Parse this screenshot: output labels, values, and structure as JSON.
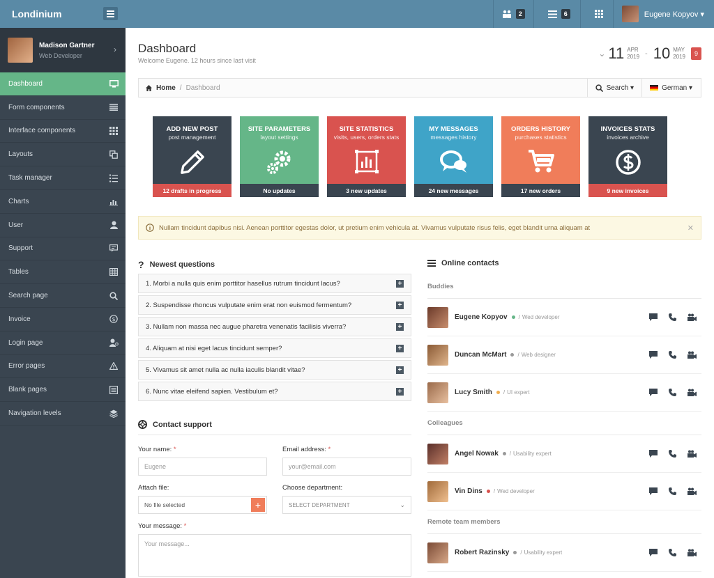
{
  "brand": "Londinium",
  "topbar": {
    "users_count": "2",
    "tasks_count": "6",
    "user_name": "Eugene Kopyov ▾"
  },
  "sidebar": {
    "user_name": "Madison Gartner",
    "user_role": "Web Developer",
    "items": [
      {
        "label": "Dashboard",
        "icon": "monitor-icon"
      },
      {
        "label": "Form components",
        "icon": "list-icon"
      },
      {
        "label": "Interface components",
        "icon": "grid-icon"
      },
      {
        "label": "Layouts",
        "icon": "copy-icon"
      },
      {
        "label": "Task manager",
        "icon": "task-list-icon"
      },
      {
        "label": "Charts",
        "icon": "bar-chart-icon"
      },
      {
        "label": "User",
        "icon": "user-icon"
      },
      {
        "label": "Support",
        "icon": "chat-icon"
      },
      {
        "label": "Tables",
        "icon": "table-icon"
      },
      {
        "label": "Search page",
        "icon": "search-icon"
      },
      {
        "label": "Invoice",
        "icon": "dollar-icon"
      },
      {
        "label": "Login page",
        "icon": "user-key-icon"
      },
      {
        "label": "Error pages",
        "icon": "warning-icon"
      },
      {
        "label": "Blank pages",
        "icon": "blank-page-icon"
      },
      {
        "label": "Navigation levels",
        "icon": "layers-icon"
      }
    ]
  },
  "page": {
    "title": "Dashboard",
    "subtitle": "Welcome Eugene. 12 hours since last visit",
    "date_from_day": "11",
    "date_from_month": "APR",
    "date_from_year": "2019",
    "date_to_day": "10",
    "date_to_month": "MAY",
    "date_to_year": "2019",
    "date_badge": "9"
  },
  "breadcrumb": {
    "home": "Home",
    "current": "Dashboard",
    "search": "Search ▾",
    "language": "German ▾"
  },
  "tiles": [
    {
      "title": "ADD NEW POST",
      "sub": "post management",
      "foot": "12 drafts in progress"
    },
    {
      "title": "SITE PARAMETERS",
      "sub": "layout settings",
      "foot": "No updates"
    },
    {
      "title": "SITE STATISTICS",
      "sub": "visits, users, orders stats",
      "foot": "3 new updates"
    },
    {
      "title": "MY MESSAGES",
      "sub": "messages history",
      "foot": "24 new messages"
    },
    {
      "title": "ORDERS HISTORY",
      "sub": "purchases statistics",
      "foot": "17 new orders"
    },
    {
      "title": "INVOICES STATS",
      "sub": "invoices archive",
      "foot": "9 new invoices"
    }
  ],
  "alert": "Nullam tincidunt dapibus nisi. Aenean porttitor egestas dolor, ut pretium enim vehicula at. Vivamus vulputate risus felis, eget blandit urna aliquam at",
  "questions": {
    "title": "Newest questions",
    "items": [
      "1. Morbi a nulla quis enim porttitor hasellus rutrum tincidunt lacus?",
      "2. Suspendisse rhoncus vulputate enim erat non euismod fermentum?",
      "3. Nullam non massa nec augue pharetra venenatis facilisis viverra?",
      "4. Aliquam at nisi eget lacus tincidunt semper?",
      "5. Vivamus sit amet nulla ac nulla iaculis blandit vitae?",
      "6. Nunc vitae eleifend sapien. Vestibulum et?"
    ]
  },
  "support": {
    "title": "Contact support",
    "name_label": "Your name:",
    "name_value": "Eugene",
    "email_label": "Email address:",
    "email_placeholder": "your@email.com",
    "file_label": "Attach file:",
    "file_value": "No file selected",
    "dept_label": "Choose department:",
    "dept_value": "SELECT DEPARTMENT",
    "message_label": "Your message:",
    "message_placeholder": "Your message..."
  },
  "contacts": {
    "title": "Online contacts",
    "groups": [
      {
        "name": "Buddies",
        "people": [
          {
            "name": "Eugene Kopyov",
            "role": "Wed developer",
            "status": "#65b688"
          },
          {
            "name": "Duncan McMart",
            "role": "Web designer",
            "status": "#999999"
          },
          {
            "name": "Lucy Smith",
            "role": "UI expert",
            "status": "#f0ad4e"
          }
        ]
      },
      {
        "name": "Colleagues",
        "people": [
          {
            "name": "Angel Nowak",
            "role": "Usability expert",
            "status": "#999999"
          },
          {
            "name": "Vin Dins",
            "role": "Wed developer",
            "status": "#d9534f"
          }
        ]
      },
      {
        "name": "Remote team members",
        "people": [
          {
            "name": "Robert Razinsky",
            "role": "Usability expert",
            "status": "#999999"
          }
        ]
      }
    ]
  },
  "colors": {
    "topbar": "#5a8aa6",
    "sidebar": "#3a4550",
    "active": "#65b688",
    "red": "#d9534f",
    "blue": "#3fa4c8",
    "orange": "#f07d5a"
  }
}
